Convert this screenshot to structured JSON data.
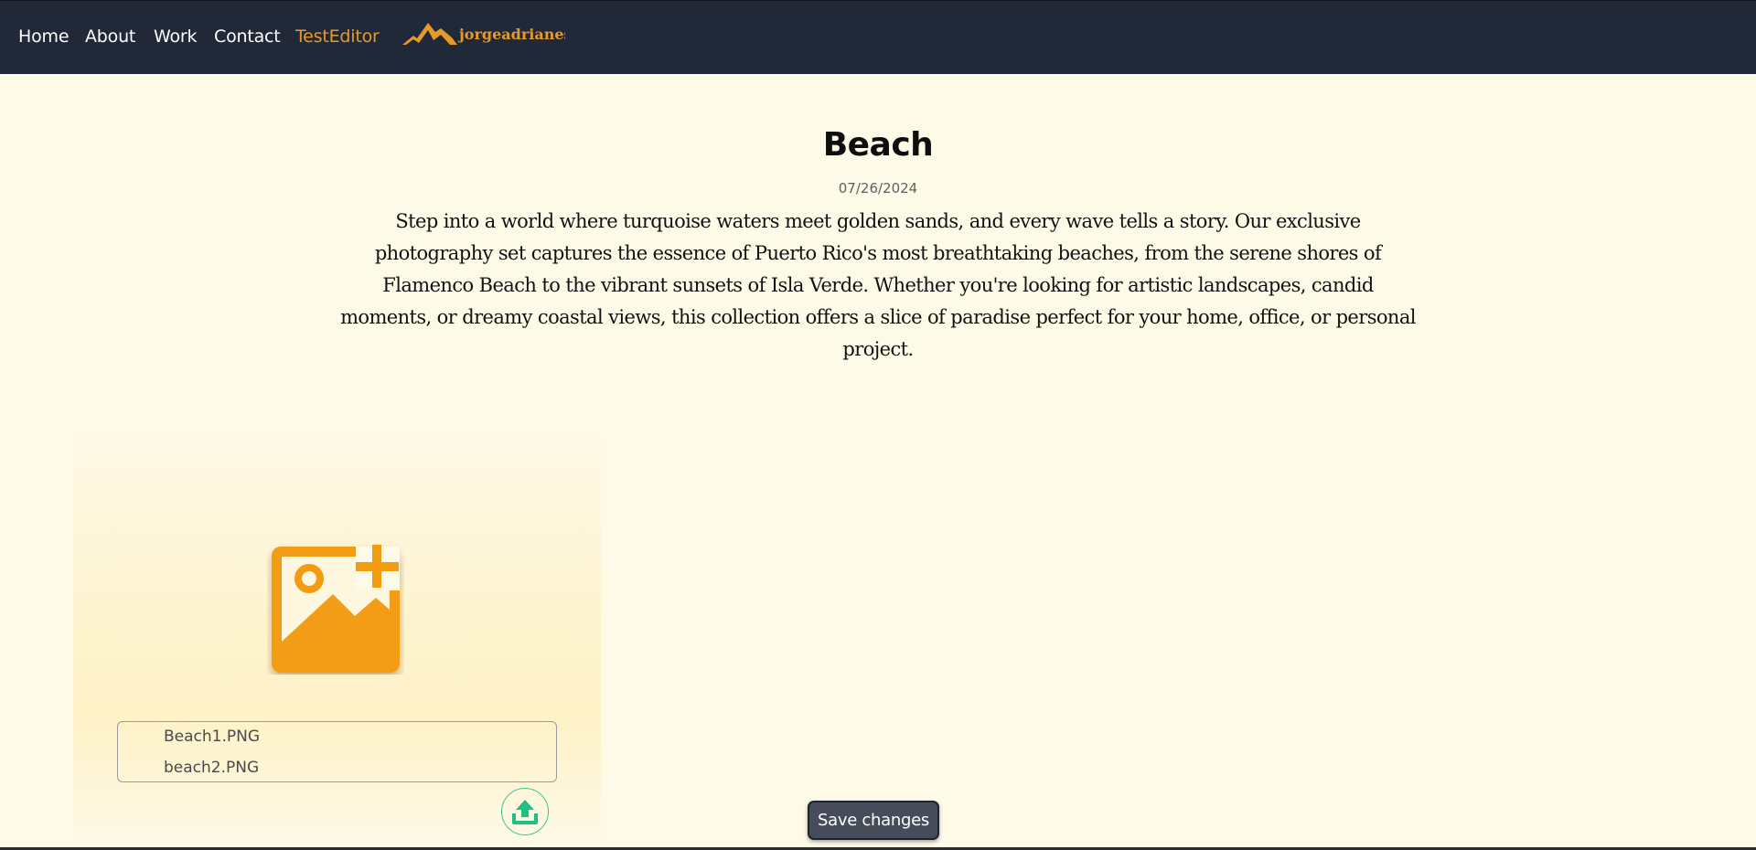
{
  "nav": {
    "links": [
      {
        "label": "Home"
      },
      {
        "label": "About"
      },
      {
        "label": "Work"
      },
      {
        "label": "Contact"
      },
      {
        "label": "TestEditor",
        "active": true
      }
    ],
    "logo_text": "jorgeadrianes"
  },
  "post": {
    "title": "Beach",
    "date": "07/26/2024",
    "description": "Step into a world where turquoise waters meet golden sands, and every wave tells a story. Our exclusive photography set captures the essence of Puerto Rico's most breathtaking beaches, from the serene shores of Flamenco Beach to the vibrant sunsets of Isla Verde. Whether you're looking for artistic landscapes, candid moments, or dreamy coastal views, this collection offers a slice of paradise perfect for your home, office, or personal project."
  },
  "uploader": {
    "files": [
      "Beach1.PNG",
      "beach2.PNG"
    ],
    "icon": "add-image-icon",
    "upload_icon": "upload-icon"
  },
  "actions": {
    "save_label": "Save changes"
  },
  "colors": {
    "navbar": "#212938",
    "accent": "#e69a2b",
    "background": "#fefae8",
    "image_icon": "#f39c12",
    "upload_icon": "#1fbf86",
    "save_button": "#454d5a"
  }
}
